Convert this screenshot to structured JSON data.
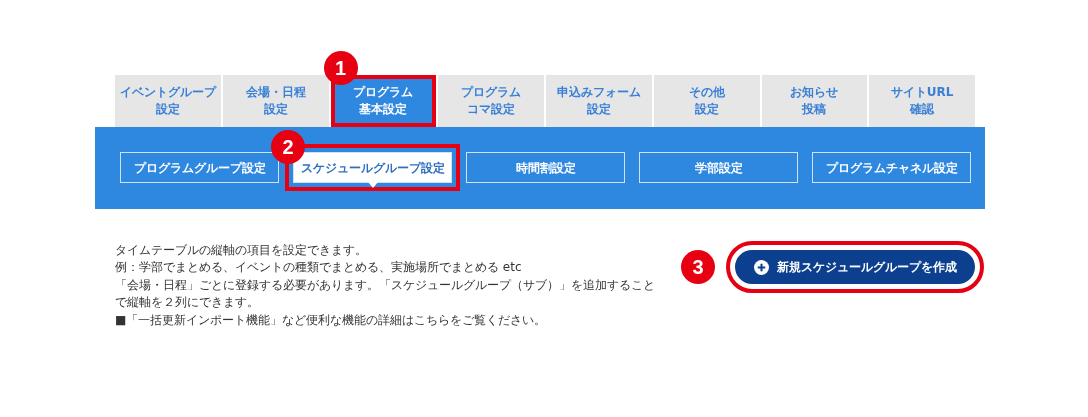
{
  "tabs": [
    {
      "label_lines": [
        "イベントグループ",
        "設定"
      ],
      "selected": false
    },
    {
      "label_lines": [
        "会場・日程",
        "設定"
      ],
      "selected": false
    },
    {
      "label_lines": [
        "プログラム",
        "基本設定"
      ],
      "selected": true,
      "callout": "1"
    },
    {
      "label_lines": [
        "プログラム",
        "コマ設定"
      ],
      "selected": false
    },
    {
      "label_lines": [
        "申込みフォーム",
        "設定"
      ],
      "selected": false
    },
    {
      "label_lines": [
        "その他",
        "設定"
      ],
      "selected": false
    },
    {
      "label_lines": [
        "お知らせ",
        "投稿"
      ],
      "selected": false
    },
    {
      "label_lines": [
        "サイトURL",
        "確認"
      ],
      "selected": false
    }
  ],
  "subtabs": [
    {
      "label": "プログラムグループ設定",
      "selected": false
    },
    {
      "label": "スケジュールグループ設定",
      "selected": true,
      "callout": "2"
    },
    {
      "label": "時間割設定",
      "selected": false
    },
    {
      "label": "学部設定",
      "selected": false
    },
    {
      "label": "プログラムチャネル設定",
      "selected": false
    }
  ],
  "description": [
    "タイムテーブルの縦軸の項目を設定できます。",
    "例：学部でまとめる、イベントの種類でまとめる、実施場所でまとめる etc",
    "「会場・日程」ごとに登録する必要があります。「スケジュールグループ（サブ）」を追加することで縦軸を２列にできます。",
    "■「一括更新インポート機能」など便利な機能の詳細はこちらをご覧ください。"
  ],
  "create_button": {
    "label": "新規スケジュールグループを作成",
    "callout": "3"
  }
}
